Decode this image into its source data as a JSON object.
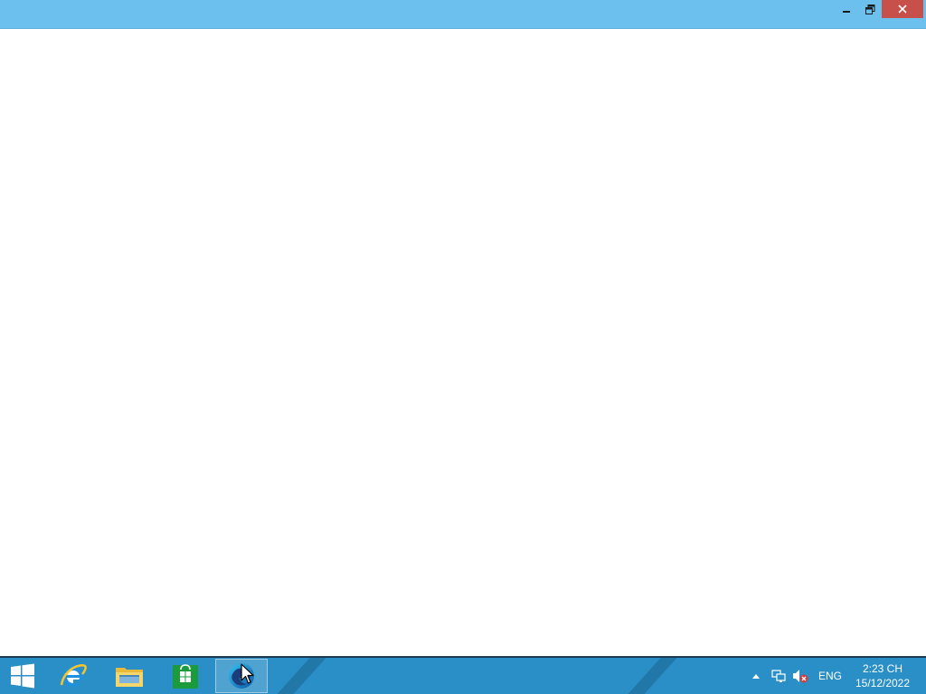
{
  "window": {
    "background": "#ffffff",
    "titlebar_color": "#6cc0ee",
    "controls": {
      "minimize_icon": "minimize-icon",
      "restore_icon": "restore-icon",
      "close_icon": "close-icon",
      "close_color": "#c7504a"
    }
  },
  "taskbar": {
    "background": "#2a8fc6",
    "start_icon": "windows-logo-icon",
    "pinned": [
      {
        "icon": "internet-explorer-icon"
      },
      {
        "icon": "file-explorer-icon"
      },
      {
        "icon": "store-icon"
      },
      {
        "icon": "edge-icon",
        "active": true
      }
    ],
    "tray": {
      "show_hidden_icon": "chevron-up-icon",
      "network_icon": "network-icon",
      "volume_icon": "volume-muted-icon",
      "language": "ENG",
      "time": "2:23 CH",
      "date": "15/12/2022"
    }
  },
  "cursor_icon": "mouse-pointer-icon"
}
